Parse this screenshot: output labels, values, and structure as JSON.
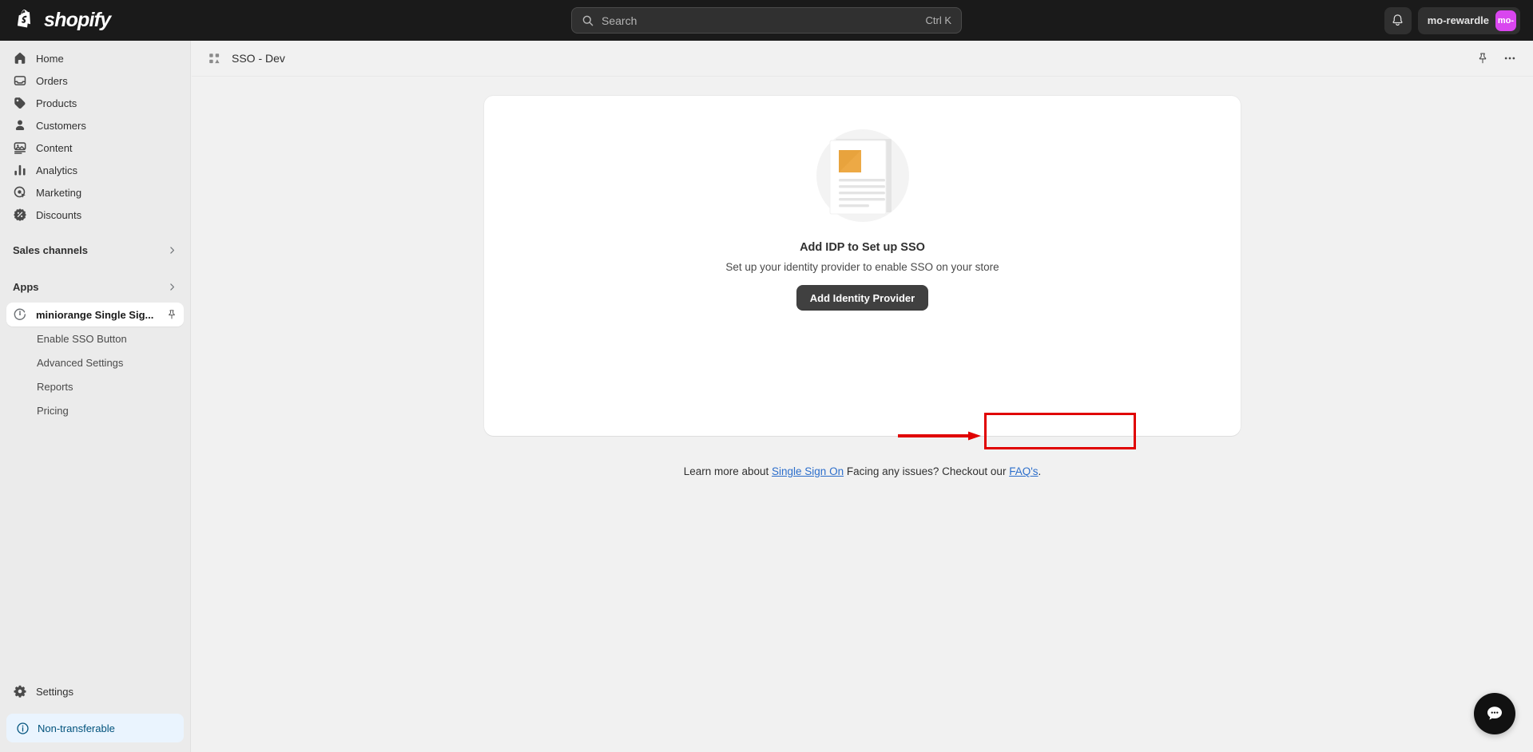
{
  "topbar": {
    "brand": "shopify",
    "brand_icon": "shopify-bag-icon",
    "search": {
      "placeholder": "Search",
      "shortcut": "Ctrl K",
      "icon": "search-icon"
    },
    "notifications_icon": "bell-icon",
    "user": {
      "name": "mo-rewardle",
      "avatar_initials": "mo-",
      "avatar_color": "#d946ef"
    }
  },
  "sidebar": {
    "items": [
      {
        "label": "Home",
        "icon": "home-icon"
      },
      {
        "label": "Orders",
        "icon": "orders-inbox-icon"
      },
      {
        "label": "Products",
        "icon": "tag-icon"
      },
      {
        "label": "Customers",
        "icon": "person-icon"
      },
      {
        "label": "Content",
        "icon": "image-content-icon"
      },
      {
        "label": "Analytics",
        "icon": "bar-chart-icon"
      },
      {
        "label": "Marketing",
        "icon": "target-icon"
      },
      {
        "label": "Discounts",
        "icon": "discount-badge-icon"
      }
    ],
    "sections": [
      {
        "label": "Sales channels",
        "icon": "chevron-right-icon"
      },
      {
        "label": "Apps",
        "icon": "chevron-right-icon"
      }
    ],
    "active_app": {
      "label": "miniorange Single Sig...",
      "icon": "miniorange-app-icon",
      "pin_icon": "pin-icon"
    },
    "app_subitems": [
      {
        "label": "Enable SSO Button"
      },
      {
        "label": "Advanced Settings"
      },
      {
        "label": "Reports"
      },
      {
        "label": "Pricing"
      }
    ],
    "settings": {
      "label": "Settings",
      "icon": "gear-icon"
    },
    "banner": {
      "label": "Non-transferable",
      "icon": "info-circle-icon",
      "color": "#00527c"
    }
  },
  "page_header": {
    "icon": "app-blocks-icon",
    "title": "SSO - Dev",
    "pin_icon": "pin-icon",
    "more_icon": "ellipsis-horizontal-icon"
  },
  "empty_state": {
    "illustration": "document-placeholder-illustration",
    "title": "Add IDP to Set up SSO",
    "subtitle": "Set up your identity provider to enable SSO on your store",
    "primary_button": "Add Identity Provider"
  },
  "annotation": {
    "box_color": "#e00000",
    "arrow_color": "#e00000",
    "arrow_icon": "right-arrow-annotation",
    "box_icon": "highlight-rectangle-annotation"
  },
  "footer": {
    "prefix": "Learn more about ",
    "link1": "Single Sign On",
    "middle": " Facing any issues? Checkout our ",
    "link2": "FAQ's",
    "suffix": "."
  },
  "chat": {
    "icon": "chat-bubble-icon"
  }
}
